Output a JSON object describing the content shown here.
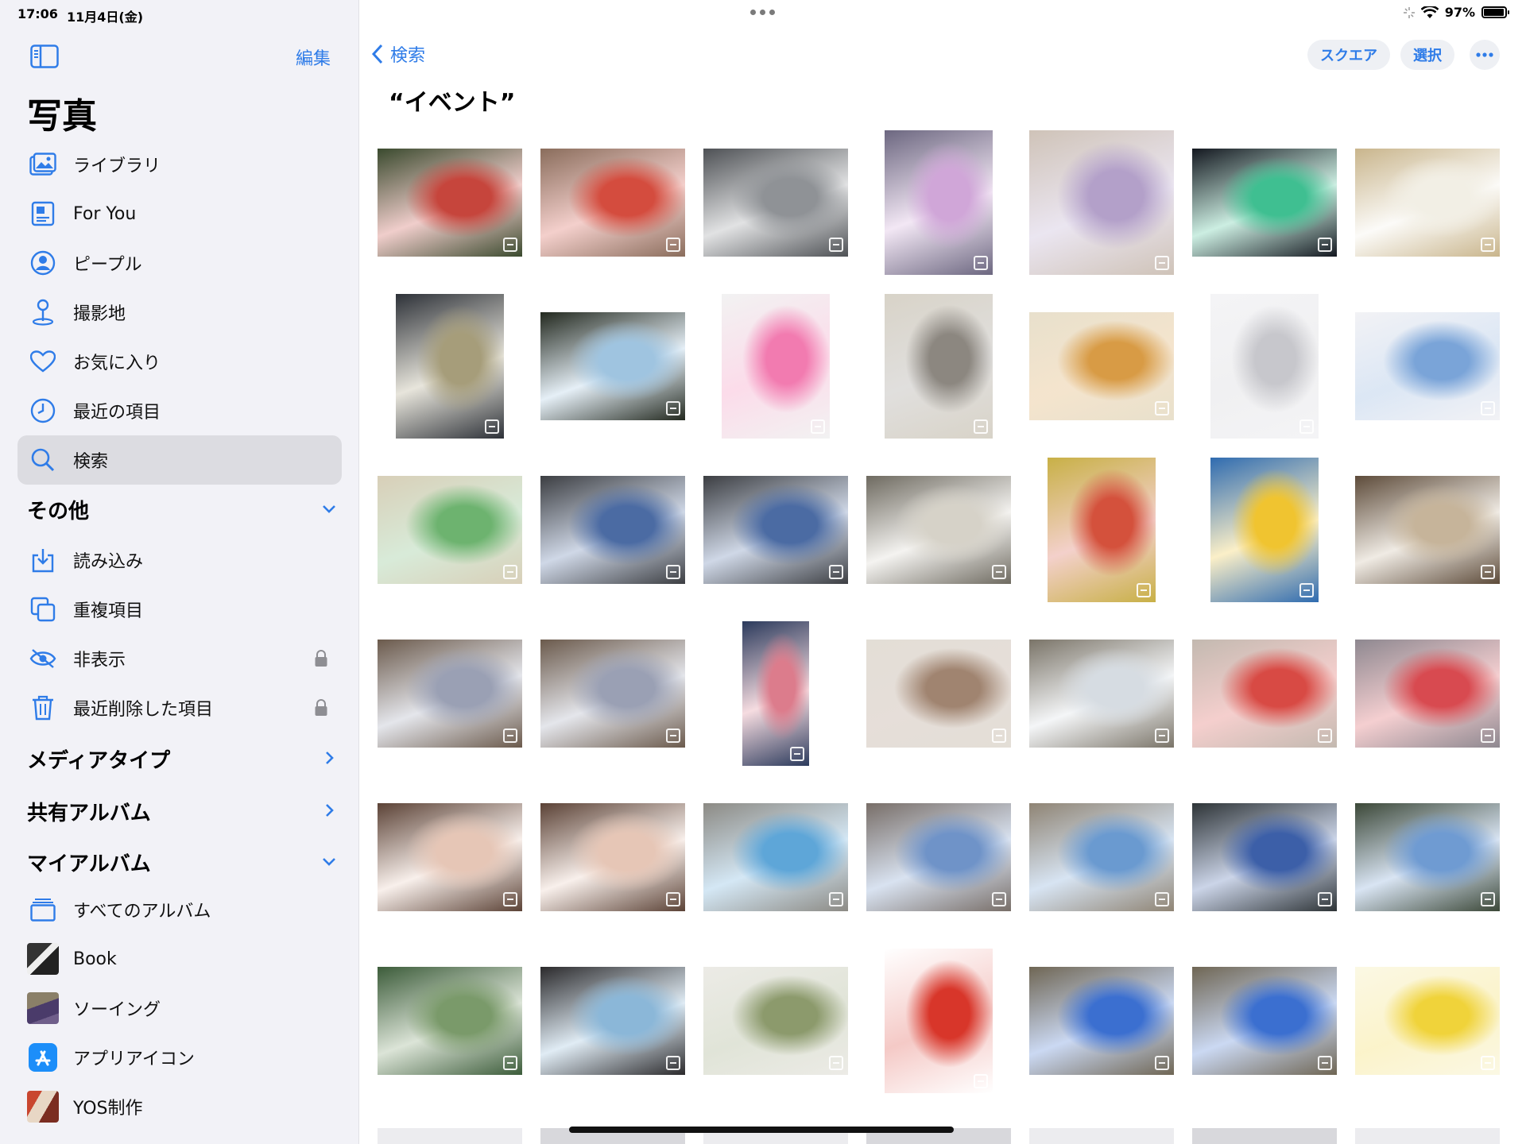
{
  "status": {
    "time": "17:06",
    "date": "11月4日(金)",
    "battery": "97%",
    "battery_level": 0.97
  },
  "sidebar": {
    "edit_label": "編集",
    "title": "写真",
    "items": [
      {
        "label": "ライブラリ",
        "icon": "photo-library-icon"
      },
      {
        "label": "For You",
        "icon": "for-you-icon"
      },
      {
        "label": "ピープル",
        "icon": "people-icon"
      },
      {
        "label": "撮影地",
        "icon": "places-icon"
      },
      {
        "label": "お気に入り",
        "icon": "heart-icon"
      },
      {
        "label": "最近の項目",
        "icon": "clock-icon"
      },
      {
        "label": "検索",
        "icon": "search-icon",
        "selected": true
      }
    ],
    "other_section": "その他",
    "other_items": [
      {
        "label": "読み込み",
        "icon": "import-icon"
      },
      {
        "label": "重複項目",
        "icon": "duplicates-icon"
      },
      {
        "label": "非表示",
        "icon": "hidden-eye-icon",
        "locked": true
      },
      {
        "label": "最近削除した項目",
        "icon": "trash-icon",
        "locked": true
      }
    ],
    "media_types_section": "メディアタイプ",
    "shared_albums_section": "共有アルバム",
    "my_albums_section": "マイアルバム",
    "albums": [
      {
        "label": "すべてのアルバム",
        "icon": "albums-icon"
      },
      {
        "label": "Book",
        "icon": "album-thumbnail"
      },
      {
        "label": "ソーイング",
        "icon": "album-thumbnail"
      },
      {
        "label": "アプリアイコン",
        "icon": "app-store-icon"
      },
      {
        "label": "YOS制作",
        "icon": "album-thumbnail"
      }
    ]
  },
  "main": {
    "back_label": "検索",
    "square_label": "スクエア",
    "select_label": "選択",
    "query": "“イベント”"
  },
  "photos": [
    {
      "c": "#3a4a2e",
      "a": "#c6453c",
      "p": "L"
    },
    {
      "c": "#8a6d5c",
      "a": "#d44c3e",
      "p": "L"
    },
    {
      "c": "#4e5155",
      "a": "#8f9296",
      "p": "L"
    },
    {
      "c": "#6c6780",
      "a": "#d0a6d8",
      "p": "P"
    },
    {
      "c": "#cfc3b8",
      "a": "#b3a0c9",
      "p": "S"
    },
    {
      "c": "#141820",
      "a": "#3fbf91",
      "p": "L"
    },
    {
      "c": "#c9b58c",
      "a": "#f2efe5",
      "p": "L"
    },
    {
      "c": "#2d3138",
      "a": "#a69d7a",
      "p": "P"
    },
    {
      "c": "#23291f",
      "a": "#9fc4e0",
      "p": "L"
    },
    {
      "c": "#f2f2f2",
      "a": "#f27bb0",
      "p": "P"
    },
    {
      "c": "#d8d3c8",
      "a": "#8c8780",
      "p": "P"
    },
    {
      "c": "#e8e0cc",
      "a": "#d89b45",
      "p": "L"
    },
    {
      "c": "#f4f4f6",
      "a": "#c7c7cc",
      "p": "P"
    },
    {
      "c": "#f2f2f5",
      "a": "#7aa4d8",
      "p": "L"
    },
    {
      "c": "#d8cfb8",
      "a": "#6db36f",
      "p": "L"
    },
    {
      "c": "#3c3e42",
      "a": "#4b6ba3",
      "p": "L"
    },
    {
      "c": "#3c3e42",
      "a": "#4b6ba3",
      "p": "L"
    },
    {
      "c": "#6e6a60",
      "a": "#d6d2c8",
      "p": "L"
    },
    {
      "c": "#c8b046",
      "a": "#d4513c",
      "p": "P"
    },
    {
      "c": "#2f6bb0",
      "a": "#f0c430",
      "p": "P"
    },
    {
      "c": "#5d4b3a",
      "a": "#c6b49a",
      "p": "L"
    },
    {
      "c": "#6b5a4c",
      "a": "#9aa0b4",
      "p": "L"
    },
    {
      "c": "#6b5a4c",
      "a": "#9aa0b4",
      "p": "L"
    },
    {
      "c": "#2b3a5c",
      "a": "#dc7c8c",
      "p": "T"
    },
    {
      "c": "#e3ded6",
      "a": "#a08470",
      "p": "L"
    },
    {
      "c": "#7a7468",
      "a": "#d6dce2",
      "p": "L"
    },
    {
      "c": "#c3b9b0",
      "a": "#d84a44",
      "p": "L"
    },
    {
      "c": "#8e8890",
      "a": "#d84a50",
      "p": "L"
    },
    {
      "c": "#5b4236",
      "a": "#e6c6b6",
      "p": "L"
    },
    {
      "c": "#5b4236",
      "a": "#e6c6b6",
      "p": "L"
    },
    {
      "c": "#8c8a84",
      "a": "#5ea6d8",
      "p": "L"
    },
    {
      "c": "#786e68",
      "a": "#6f93c8",
      "p": "L"
    },
    {
      "c": "#8f8474",
      "a": "#6a9ad0",
      "p": "L"
    },
    {
      "c": "#2e3437",
      "a": "#3c5fa8",
      "p": "L"
    },
    {
      "c": "#3c4838",
      "a": "#6f9bd2",
      "p": "L"
    },
    {
      "c": "#3c5c3a",
      "a": "#7a9a6a",
      "p": "L"
    },
    {
      "c": "#2b2a2c",
      "a": "#8bb7d8",
      "p": "L"
    },
    {
      "c": "#ecebe6",
      "a": "#8c9a6c",
      "p": "L"
    },
    {
      "c": "#ffffff",
      "a": "#d8362a",
      "p": "P"
    },
    {
      "c": "#6f6654",
      "a": "#3b6fd0",
      "p": "L"
    },
    {
      "c": "#6f6654",
      "a": "#3b6fd0",
      "p": "L"
    },
    {
      "c": "#fbf8e4",
      "a": "#f0d33a",
      "p": "L"
    }
  ]
}
